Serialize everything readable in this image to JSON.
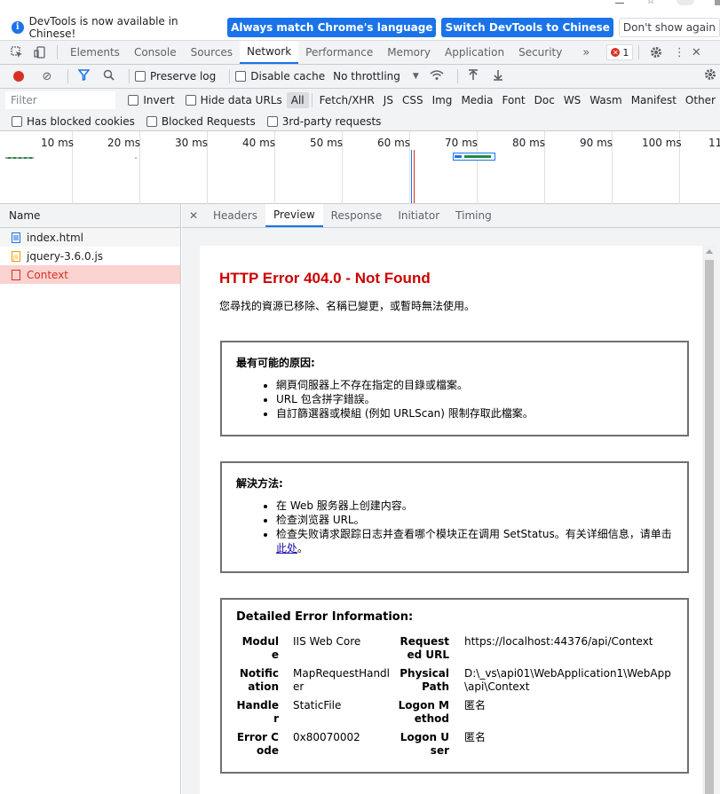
{
  "infobar": {
    "message": "DevTools is now available in Chinese!",
    "btn_match": "Always match Chrome's language",
    "btn_switch": "Switch DevTools to Chinese",
    "btn_dismiss": "Don't show again"
  },
  "main_tabs": [
    "Elements",
    "Console",
    "Sources",
    "Network",
    "Performance",
    "Memory",
    "Application",
    "Security"
  ],
  "main_tab_active": "Network",
  "error_count": "1",
  "network_toolbar": {
    "preserve_log": "Preserve log",
    "disable_cache": "Disable cache",
    "throttling": "No throttling"
  },
  "filter": {
    "placeholder": "Filter",
    "invert": "Invert",
    "hide_data_urls": "Hide data URLs",
    "types": [
      "All",
      "Fetch/XHR",
      "JS",
      "CSS",
      "Img",
      "Media",
      "Font",
      "Doc",
      "WS",
      "Wasm",
      "Manifest",
      "Other"
    ],
    "has_blocked_cookies": "Has blocked cookies",
    "blocked_requests": "Blocked Requests",
    "third_party": "3rd-party requests"
  },
  "timeline_ticks": [
    "10 ms",
    "20 ms",
    "30 ms",
    "40 ms",
    "50 ms",
    "60 ms",
    "70 ms",
    "80 ms",
    "90 ms",
    "100 ms",
    "11"
  ],
  "request_list": {
    "header": "Name",
    "rows": [
      {
        "name": "index.html",
        "type": "doc"
      },
      {
        "name": "jquery-3.6.0.js",
        "type": "js"
      },
      {
        "name": "Context",
        "type": "error"
      }
    ]
  },
  "detail_tabs": [
    "Headers",
    "Preview",
    "Response",
    "Initiator",
    "Timing"
  ],
  "detail_tab_active": "Preview",
  "preview": {
    "title": "HTTP Error 404.0 - Not Found",
    "subtitle": "您尋找的資源已移除、名稱已變更，或暫時無法使用。",
    "causes_title": "最有可能的原因:",
    "causes": [
      "網頁伺服器上不存在指定的目錄或檔案。",
      "URL 包含拼字錯誤。",
      "自訂篩選器或模組 (例如 URLScan) 限制存取此檔案。"
    ],
    "solutions_title": "解決方法:",
    "solutions": [
      "在 Web 服务器上创建内容。",
      "检查浏览器 URL。"
    ],
    "solution_last": "检查失败请求跟踪日志并查看哪个模块正在调用 SetStatus。有关详细信息，请单击",
    "solution_link": "此处",
    "solution_end": "。",
    "details_title": "Detailed Error Information:",
    "details": {
      "module_key": "Module",
      "module_val": "IIS Web Core",
      "notification_key": "Notification",
      "notification_val": "MapRequestHandler",
      "handler_key": "Handler",
      "handler_val": "StaticFile",
      "error_code_key": "Error Code",
      "error_code_val": "0x80070002",
      "requested_url_key": "Requested URL",
      "requested_url_val": "https://localhost:44376/api/Context",
      "physical_path_key": "Physical Path",
      "physical_path_val": "D:\\_vs\\api01\\WebApplication1\\WebApp\\api\\Context",
      "logon_method_key": "Logon Method",
      "logon_method_val": "匿名",
      "logon_user_key": "Logon User",
      "logon_user_val": "匿名"
    }
  }
}
